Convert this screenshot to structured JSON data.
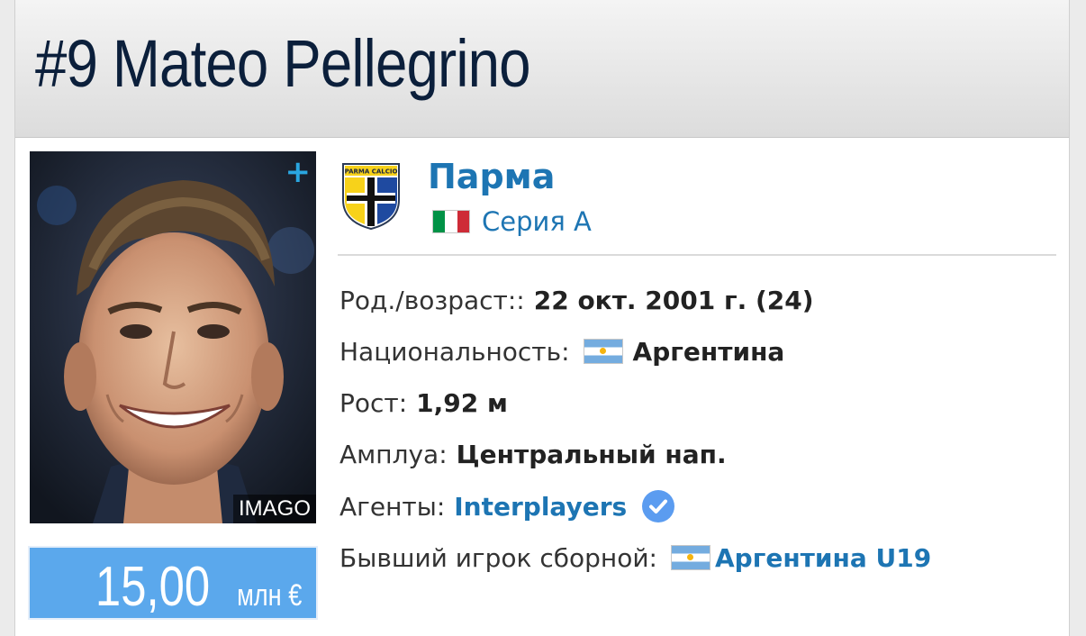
{
  "header": {
    "title": "#9 Mateo Pellegrino"
  },
  "photo": {
    "credit": "IMAGO",
    "add_label": "+"
  },
  "market_value": {
    "amount": "15,00",
    "unit": "млн €"
  },
  "club": {
    "name": "Парма",
    "crest_text": "PARMA CALCIO",
    "league": "Серия А",
    "league_flag_colors": [
      "#009246",
      "#ffffff",
      "#ce2b37"
    ]
  },
  "details": {
    "birth": {
      "label": "Род./возраст::",
      "value": "22 окт. 2001 г. (24)"
    },
    "nationality": {
      "label": "Национальность:",
      "value": "Аргентина",
      "flag": "argentina-flag"
    },
    "height": {
      "label": "Рост:",
      "value": "1,92 м"
    },
    "position": {
      "label": "Амплуа:",
      "value": "Центральный нап."
    },
    "agents": {
      "label": "Агенты:",
      "value": "Interplayers",
      "badge": "verified-icon"
    },
    "former_international": {
      "label": "Бывший игрок сборной:",
      "value": "Аргентина U19",
      "flag": "argentina-flag"
    }
  },
  "colors": {
    "title": "#0b1f3b",
    "link": "#1d75b3",
    "value_box": "#5ba8ec",
    "plus": "#2aa6e0",
    "verified": "#5b9cf0"
  }
}
